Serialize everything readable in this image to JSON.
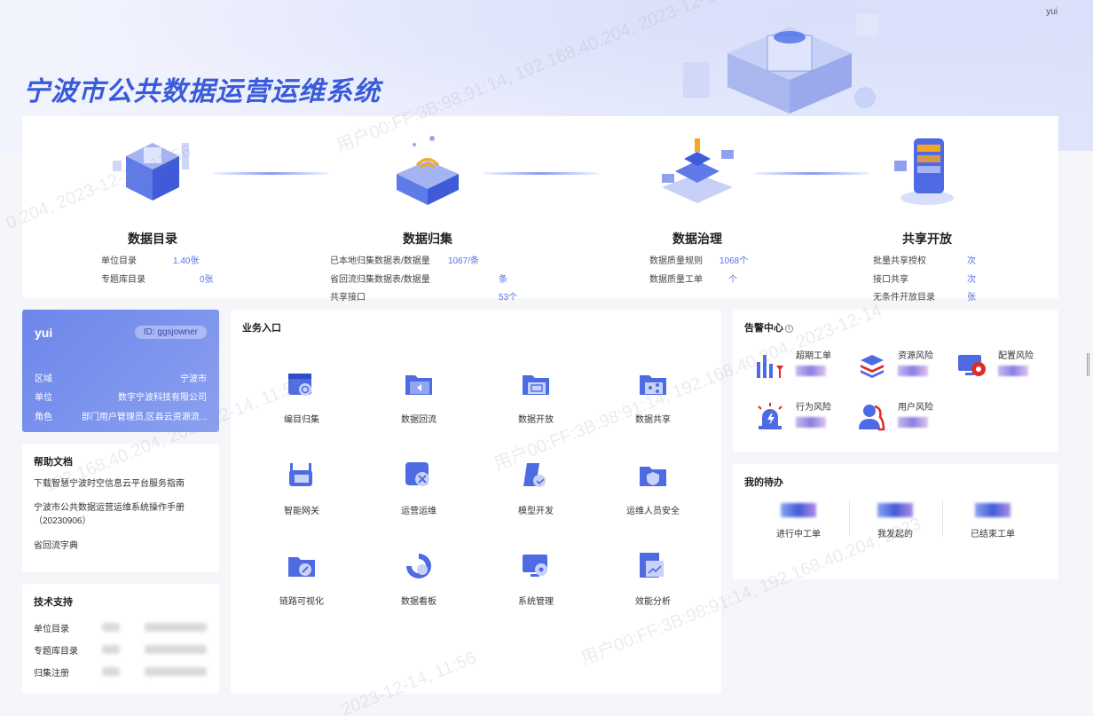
{
  "header": {
    "title": "宁波市公共数据运营运维系统",
    "user": "yui"
  },
  "stats": [
    {
      "title": "数据目录",
      "rows": [
        {
          "label": "单位目录",
          "value": "1.40张"
        },
        {
          "label": "专题库目录",
          "value": "0张"
        }
      ]
    },
    {
      "title": "数据归集",
      "rows": [
        {
          "label": "已本地归集数据表/数据量",
          "value": "1067/条"
        },
        {
          "label": "省回流归集数据表/数据量",
          "value": "条"
        },
        {
          "label": "共享接口",
          "value": "53个"
        }
      ]
    },
    {
      "title": "数据治理",
      "rows": [
        {
          "label": "数据质量规则",
          "value": "1068个"
        },
        {
          "label": "数据质量工单",
          "value": "个"
        }
      ]
    },
    {
      "title": "共享开放",
      "rows": [
        {
          "label": "批量共享授权",
          "value": "次"
        },
        {
          "label": "接口共享",
          "value": "次"
        },
        {
          "label": "无条件开放目录",
          "value": "张"
        }
      ]
    }
  ],
  "user_card": {
    "name": "yui",
    "id_badge": "ID: ggsjowner",
    "rows": [
      {
        "label": "区域",
        "value": "宁波市"
      },
      {
        "label": "单位",
        "value": "数字宁波科技有限公司"
      },
      {
        "label": "角色",
        "value": "部门用户管理员,区县云资源流..."
      }
    ]
  },
  "help": {
    "title": "帮助文档",
    "items": [
      "下载智慧宁波时空信息云平台服务指南",
      "宁波市公共数据运营运维系统操作手册（20230906）",
      "省回流字典"
    ]
  },
  "tech": {
    "title": "技术支持",
    "rows": [
      "单位目录",
      "专题库目录",
      "归集注册"
    ]
  },
  "biz": {
    "title": "业务入口",
    "items": [
      {
        "label": "编目归集",
        "icon": "catalog-icon"
      },
      {
        "label": "数据回流",
        "icon": "folder-return-icon"
      },
      {
        "label": "数据开放",
        "icon": "folder-open-icon"
      },
      {
        "label": "数据共享",
        "icon": "folder-share-icon"
      },
      {
        "label": "智能网关",
        "icon": "gateway-icon"
      },
      {
        "label": "运营运维",
        "icon": "tools-icon"
      },
      {
        "label": "模型开发",
        "icon": "model-icon"
      },
      {
        "label": "运维人员安全",
        "icon": "folder-shield-icon"
      },
      {
        "label": "链路可视化",
        "icon": "folder-link-icon"
      },
      {
        "label": "数据看板",
        "icon": "dashboard-icon"
      },
      {
        "label": "系统管理",
        "icon": "system-icon"
      },
      {
        "label": "效能分析",
        "icon": "analysis-icon"
      }
    ]
  },
  "alarm": {
    "title": "告警中心",
    "items": [
      {
        "label": "超期工单",
        "icon": "bar-chart-icon"
      },
      {
        "label": "资源风险",
        "icon": "layers-icon"
      },
      {
        "label": "配置风险",
        "icon": "config-gear-icon"
      },
      {
        "label": "行为风险",
        "icon": "siren-icon"
      },
      {
        "label": "用户风险",
        "icon": "user-risk-icon"
      }
    ]
  },
  "todo": {
    "title": "我的待办",
    "items": [
      "进行中工单",
      "我发起的",
      "已结束工单"
    ]
  },
  "colors": {
    "accent": "#3a5bd9",
    "card_gradient": "#6d86ea"
  }
}
